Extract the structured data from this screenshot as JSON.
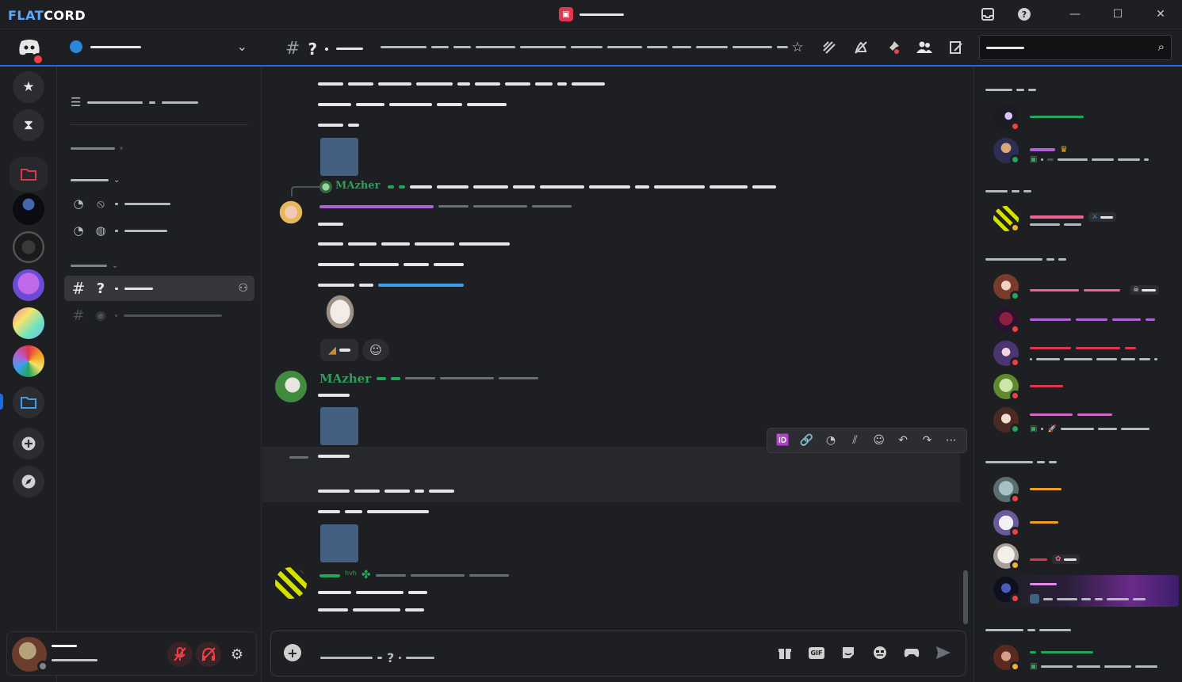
{
  "app": {
    "brand_a": "FLAT",
    "brand_b": "CORD"
  },
  "window": {
    "minimize": "—",
    "maximize": "☐",
    "close": "✕"
  },
  "channel": {
    "hash": "#",
    "emoji": "?"
  },
  "chat": {
    "messages": [
      {
        "username": "MAzher",
        "color": "#2e9e5b"
      },
      {
        "username": "MAzher",
        "color": "#2e9e5b"
      }
    ],
    "small_label": "hvh"
  },
  "composer": {
    "emoji": "?",
    "gif_label": "GIF"
  },
  "colors": {
    "accent": "#1b6fe0",
    "dnd": "#f23f43",
    "online": "#23a55a",
    "idle": "#f0b232",
    "offline": "#80848e",
    "role_green": "#23a55a",
    "role_purple": "#b260d6",
    "role_pink": "#f06292",
    "role_red": "#e0364f",
    "role_orange": "#f0a020",
    "link_blue": "#3d9ff0"
  },
  "icons": {
    "titlebar": [
      "inbox-icon",
      "help-icon"
    ],
    "header": [
      "star-icon",
      "threads-icon",
      "mute-icon",
      "pin-icon",
      "members-icon",
      "notes-icon",
      "search-icon"
    ],
    "message_toolbar": [
      "id-icon",
      "link-icon",
      "thread-icon",
      "forward-icon",
      "reaction-icon",
      "reply-icon",
      "share-icon",
      "more-icon"
    ],
    "composer": [
      "gift-icon",
      "gif-icon",
      "sticker-icon",
      "emoji-icon",
      "game-icon",
      "send-icon"
    ]
  }
}
